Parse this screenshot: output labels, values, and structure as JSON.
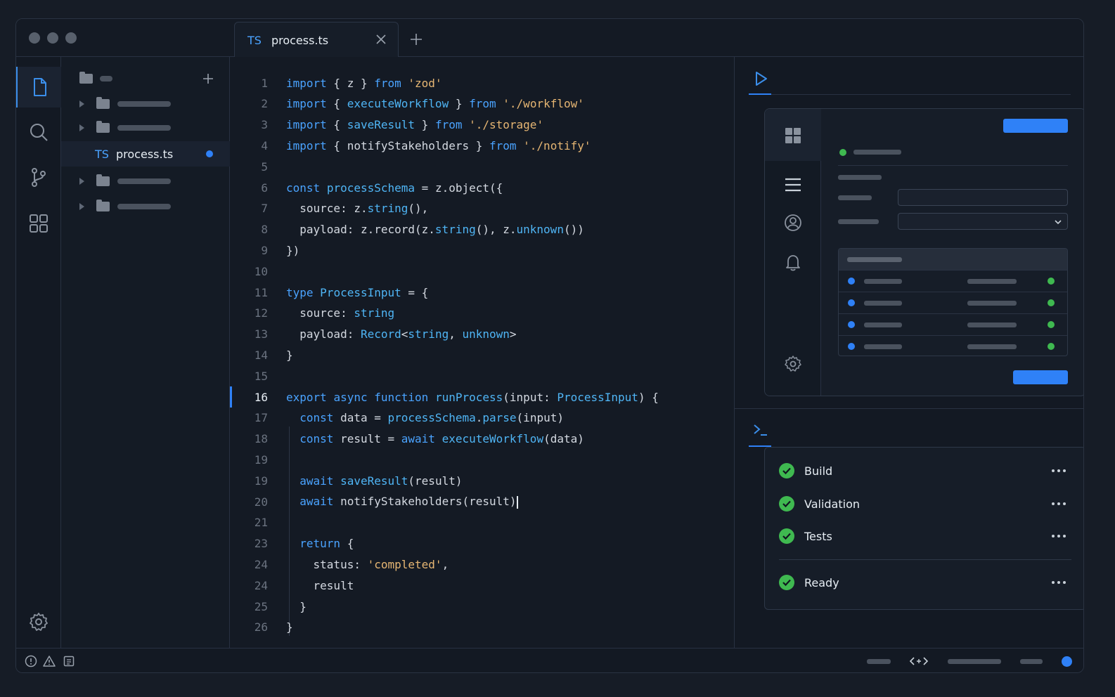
{
  "window": {
    "traffic_lights": [
      "close",
      "minimize",
      "zoom"
    ]
  },
  "tab": {
    "type_badge": "TS",
    "filename": "process.ts",
    "close_icon": "close-icon",
    "add_icon": "plus-icon"
  },
  "activity_bar": {
    "items": [
      "files-icon",
      "search-icon",
      "source-control-icon",
      "extensions-icon"
    ],
    "bottom": "settings-icon"
  },
  "explorer": {
    "add_icon": "plus-icon",
    "open_file": {
      "badge": "TS",
      "name": "process.ts",
      "modified": true
    }
  },
  "editor": {
    "active_line": "16",
    "lines": [
      {
        "n": "1",
        "code": "import { z } from 'zod'"
      },
      {
        "n": "2",
        "code": "import { executeWorkflow } from './workflow'"
      },
      {
        "n": "3",
        "code": "import { saveResult } from './storage'"
      },
      {
        "n": "4",
        "code": "import { notifyStakeholders } from './notify'"
      },
      {
        "n": "5",
        "code": ""
      },
      {
        "n": "6",
        "code": "const processSchema = z.object({"
      },
      {
        "n": "7",
        "code": "  source: z.string(),"
      },
      {
        "n": "8",
        "code": "  payload: z.record(z.string(), z.unknown())"
      },
      {
        "n": "9",
        "code": "})"
      },
      {
        "n": "10",
        "code": ""
      },
      {
        "n": "11",
        "code": "type ProcessInput = {"
      },
      {
        "n": "12",
        "code": "  source: string"
      },
      {
        "n": "13",
        "code": "  payload: Record<string, unknown>"
      },
      {
        "n": "14",
        "code": "}"
      },
      {
        "n": "15",
        "code": ""
      },
      {
        "n": "16",
        "code": "export async function runProcess(input: ProcessInput) {"
      },
      {
        "n": "17",
        "code": "  const data = processSchema.parse(input)"
      },
      {
        "n": "18",
        "code": "  const result = await executeWorkflow(data)"
      },
      {
        "n": "19",
        "code": ""
      },
      {
        "n": "19",
        "code": "  await saveResult(result)"
      },
      {
        "n": "20",
        "code": "  await notifyStakeholders(result)"
      },
      {
        "n": "21",
        "code": ""
      },
      {
        "n": "23",
        "code": "  return {"
      },
      {
        "n": "24",
        "code": "    status: 'completed',"
      },
      {
        "n": "24",
        "code": "    result"
      },
      {
        "n": "25",
        "code": "  }"
      },
      {
        "n": "26",
        "code": "}"
      }
    ]
  },
  "right_panel": {
    "preview_tab_icon": "play-icon",
    "terminal_tab_icon": "terminal-icon",
    "preview_sidebar_icons": [
      "grid-icon",
      "menu-icon",
      "user-icon",
      "bell-icon",
      "settings-icon"
    ],
    "checks": [
      {
        "label": "Build",
        "status": "passed"
      },
      {
        "label": "Validation",
        "status": "passed"
      },
      {
        "label": "Tests",
        "status": "passed"
      },
      {
        "label": "Ready",
        "status": "passed"
      }
    ]
  },
  "status_bar": {
    "left_icons": [
      "error-icon",
      "warning-icon",
      "info-icon"
    ],
    "right_icon": "code-icon"
  },
  "colors": {
    "accent": "#2f81f7",
    "keyword": "#4aa3ff",
    "string": "#e6b673",
    "success": "#3fb950"
  }
}
